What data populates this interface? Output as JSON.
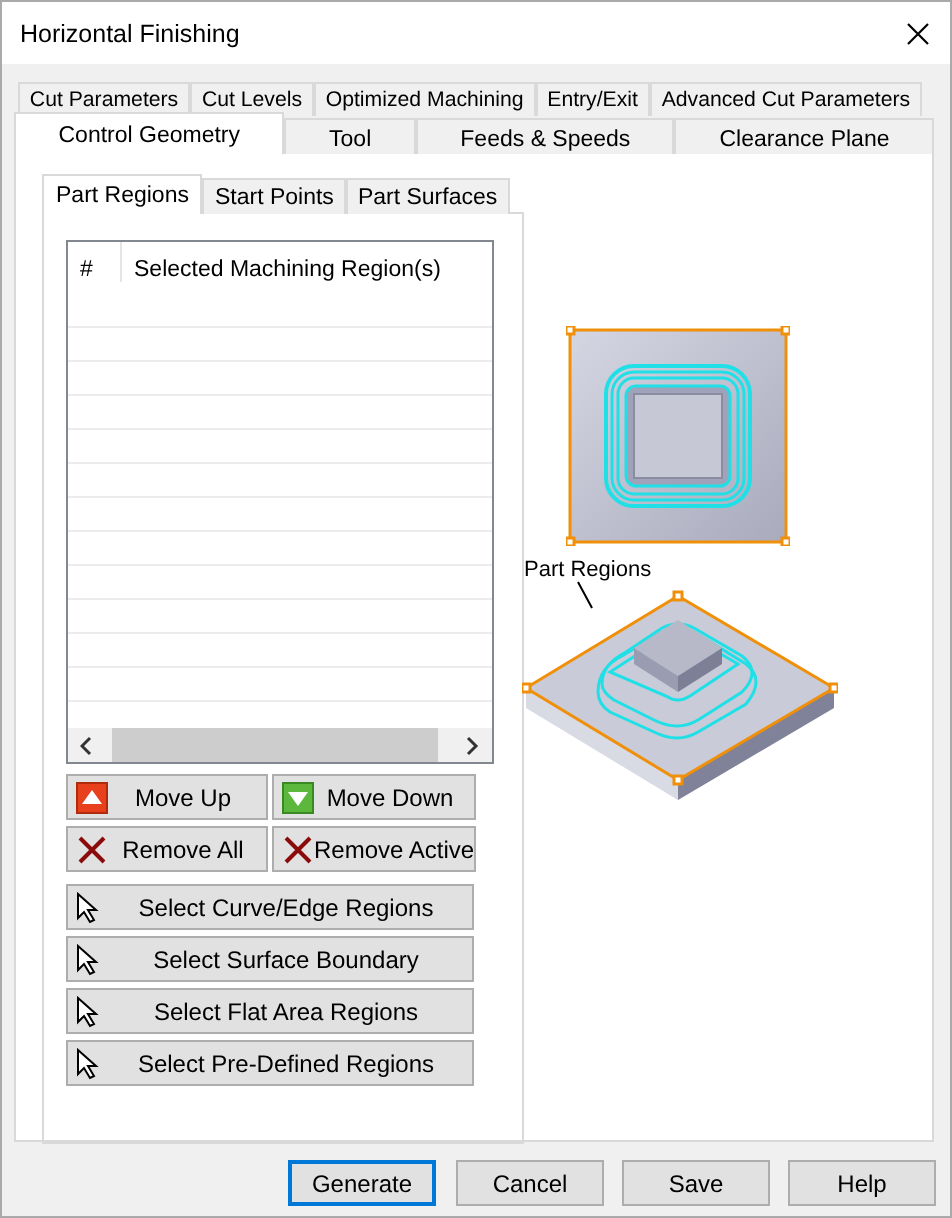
{
  "window": {
    "title": "Horizontal Finishing"
  },
  "tab_rows": [
    [
      {
        "label": "Cut Parameters",
        "selected": false
      },
      {
        "label": "Cut Levels",
        "selected": false
      },
      {
        "label": "Optimized Machining",
        "selected": false
      },
      {
        "label": "Entry/Exit",
        "selected": false
      },
      {
        "label": "Advanced Cut Parameters",
        "selected": false
      }
    ],
    [
      {
        "label": "Control Geometry",
        "selected": true
      },
      {
        "label": "Tool",
        "selected": false
      },
      {
        "label": "Feeds & Speeds",
        "selected": false
      },
      {
        "label": "Clearance Plane",
        "selected": false
      }
    ]
  ],
  "sub_tabs": [
    {
      "label": "Part Regions",
      "selected": true
    },
    {
      "label": "Start Points",
      "selected": false
    },
    {
      "label": "Part Surfaces",
      "selected": false
    }
  ],
  "region_list": {
    "columns": [
      "#",
      "Selected Machining Region(s)"
    ]
  },
  "list_buttons": [
    {
      "label": "Move Up",
      "kind": "up"
    },
    {
      "label": "Move Down",
      "kind": "down"
    },
    {
      "label": "Remove All",
      "kind": "remove"
    },
    {
      "label": "Remove Active",
      "kind": "remove"
    }
  ],
  "select_buttons": [
    {
      "label": "Select Curve/Edge Regions",
      "kind": "pointer"
    },
    {
      "label": "Select Surface Boundary",
      "kind": "pointer"
    },
    {
      "label": "Select Flat Area Regions",
      "kind": "pointer"
    },
    {
      "label": "Select Pre-Defined Regions",
      "kind": "pointer"
    }
  ],
  "illustration": {
    "label": "Part Regions"
  },
  "footer_buttons": [
    {
      "label": "Generate",
      "default": true
    },
    {
      "label": "Cancel",
      "default": false
    },
    {
      "label": "Save",
      "default": false
    },
    {
      "label": "Help",
      "default": false
    }
  ]
}
